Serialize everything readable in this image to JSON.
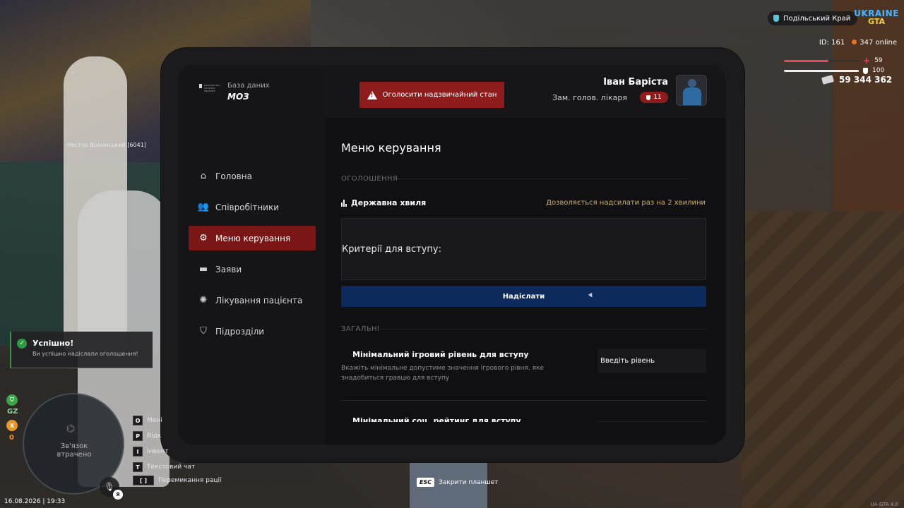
{
  "hud": {
    "region": "Подільський Край",
    "logo_line1": "UKRAINE",
    "logo_line2": "GTA",
    "id": "ID: 161",
    "online": "347 online",
    "health_value": "59",
    "health_percent": 59,
    "armor_value": "100",
    "armor_percent": 100,
    "money": "59 344 362",
    "player_tag": "Нестор Волинський [6041]",
    "status_gz": "GZ",
    "status_zero": "0",
    "map_lost": "Зв'язок втрачено",
    "lang": "Я",
    "datetime": "16.08.2026 | 19:33",
    "version": "UA-GTA 4.0",
    "esc_key": "ESC",
    "esc_label": "Закрити планшет",
    "keys": [
      {
        "key": "O",
        "label": "Мені"
      },
      {
        "key": "P",
        "label": "Відк"
      },
      {
        "key": "I",
        "label": "Інвент"
      },
      {
        "key": "T",
        "label": "Текстовий чат"
      },
      {
        "key": "[ ]",
        "label": "Перемикання рації"
      }
    ]
  },
  "toast": {
    "title": "Успішно!",
    "text": "Ви успішно надіслали оголошення!"
  },
  "header": {
    "db_label": "База даних",
    "db_title": "МОЗ",
    "emergency_label": "Оголосити надзвичайний стан",
    "user_name": "Іван Баріста",
    "user_role": "Зам. голов. лікаря",
    "rank": "11"
  },
  "nav": {
    "items": [
      {
        "label": "Головна"
      },
      {
        "label": "Співробітники"
      },
      {
        "label": "Меню керування"
      },
      {
        "label": "Заяви"
      },
      {
        "label": "Лікування пацієнта"
      },
      {
        "label": "Підрозділи"
      }
    ]
  },
  "main": {
    "title": "Меню керування",
    "section_announcements": "ОГОЛОШЕННЯ",
    "wave_title": "Державна хвиля",
    "wave_note": "Дозволяється надсилати раз на 2 хвилини",
    "textarea_value": "Критерії для вступу:",
    "send_label": "Надіслати",
    "section_general": "ЗАГАЛЬНІ",
    "setting1_title": "Мінімальний ігровий рівень для вступу",
    "setting1_desc": "Вкажіть мінімальне допустиме значення ігрового рівня, яке знадобиться гравцю для вступу",
    "setting1_placeholder": "Введіть рівень",
    "setting2_title": "Мінімальний соц. рейтинг для вступу"
  },
  "colors": {
    "accent_red": "#8e1c1c",
    "send_blue": "#0d2a5c",
    "note_gold": "#d8b25a",
    "success_green": "#2f9a46"
  }
}
